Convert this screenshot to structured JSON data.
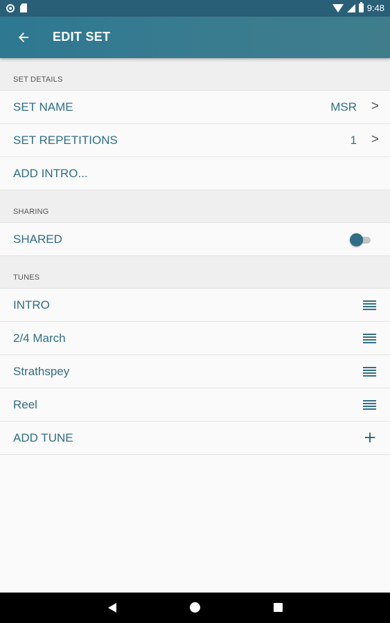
{
  "status_bar": {
    "time": "9:48",
    "icons": [
      "circle-notification-icon",
      "sd-card-icon",
      "wifi-icon",
      "signal-icon",
      "battery-icon"
    ]
  },
  "app_bar": {
    "title": "EDIT SET",
    "back_icon": "arrow-back-icon",
    "color": "#2e7891"
  },
  "sections": {
    "set_details": {
      "header": "SET DETAILS",
      "set_name": {
        "label": "SET NAME",
        "value": "MSR",
        "chevron": ">"
      },
      "set_repetitions": {
        "label": "SET REPETITIONS",
        "value": "1",
        "chevron": ">"
      },
      "add_intro": {
        "label": "ADD INTRO..."
      }
    },
    "sharing": {
      "header": "SHARING",
      "shared": {
        "label": "SHARED",
        "toggle_on": false
      }
    },
    "tunes": {
      "header": "TUNES",
      "items": [
        {
          "label": "INTRO"
        },
        {
          "label": "2/4 March"
        },
        {
          "label": "Strathspey"
        },
        {
          "label": "Reel"
        }
      ],
      "add_tune": {
        "label": "ADD TUNE"
      }
    }
  },
  "nav_bar": {
    "buttons": [
      "back-triangle-icon",
      "home-circle-icon",
      "recents-square-icon"
    ]
  },
  "colors": {
    "accent": "#2f6e86",
    "status_bar": "#2a5f78",
    "background": "#fafafa",
    "section_header": "#efefef"
  }
}
